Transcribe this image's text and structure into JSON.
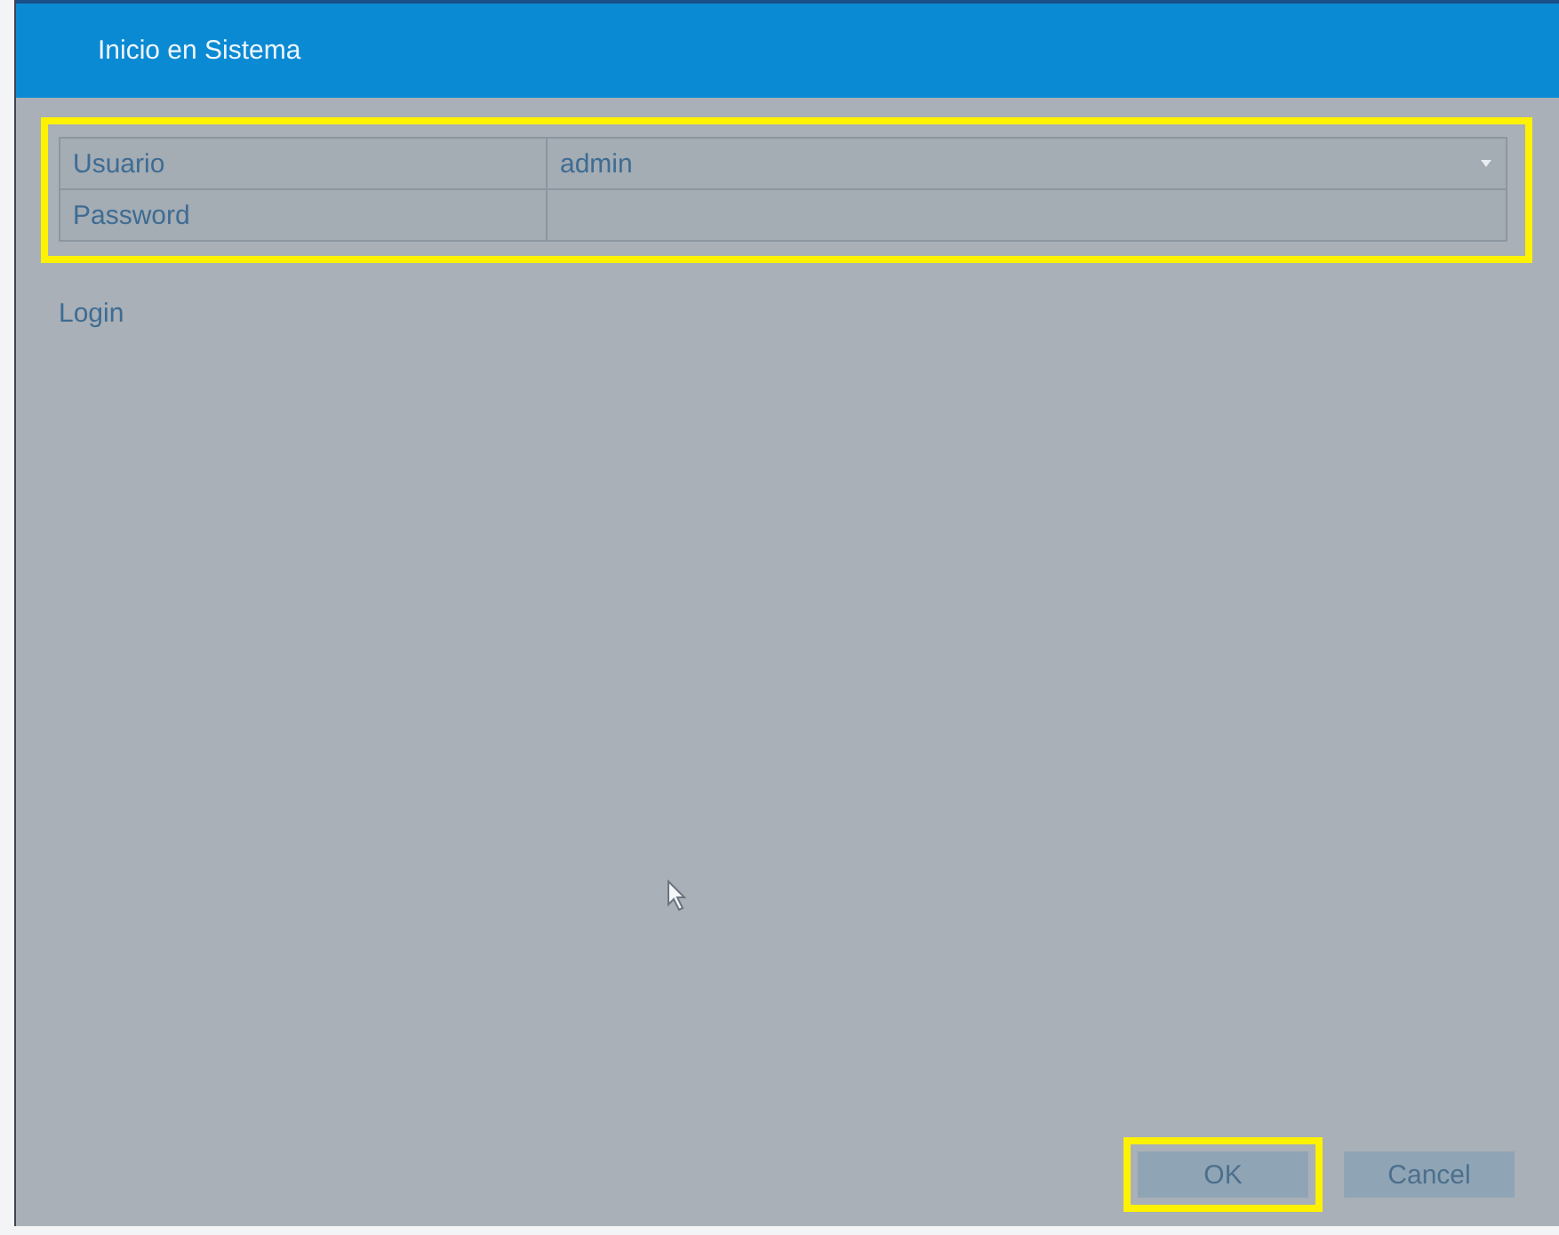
{
  "window": {
    "title": "Inicio en Sistema"
  },
  "form": {
    "highlighted": true,
    "fields": [
      {
        "label": "Usuario",
        "kind": "dropdown",
        "value": "admin"
      },
      {
        "label": "Password",
        "kind": "password"
      }
    ]
  },
  "section_label": "Login",
  "buttons": [
    {
      "label": "OK",
      "highlighted": true
    },
    {
      "label": "Cancel",
      "highlighted": false
    }
  ]
}
